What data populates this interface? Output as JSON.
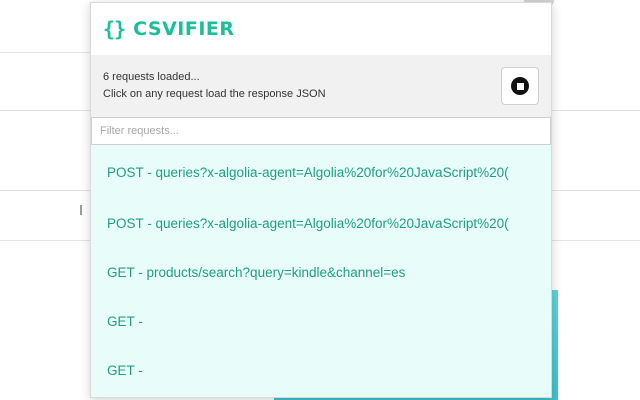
{
  "app": {
    "brand_icon": "{}",
    "brand_name": "CSVIFIER"
  },
  "status": {
    "line1": "6 requests loaded...",
    "line2": "Click on any request load the response JSON",
    "stop_icon": "stop-circle-icon"
  },
  "filter": {
    "value": "",
    "placeholder": "Filter requests..."
  },
  "requests": [
    {
      "label": "POST - queries?x-algolia-agent=Algolia%20for%20JavaScript%20("
    },
    {
      "label": "POST - queries?x-algolia-agent=Algolia%20for%20JavaScript%20("
    },
    {
      "label": "GET - products/search?query=kindle&channel=es"
    },
    {
      "label": "GET -"
    },
    {
      "label": "GET -"
    }
  ],
  "colors": {
    "accent": "#1bbf9a",
    "list_background": "#e8fdf9",
    "list_text": "#1f9d86"
  }
}
